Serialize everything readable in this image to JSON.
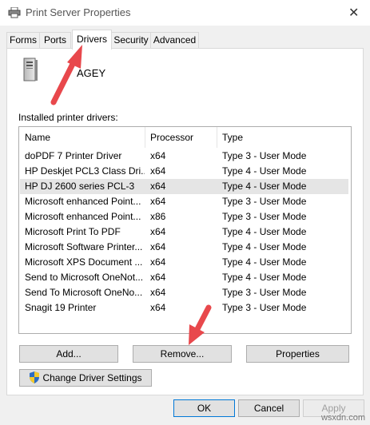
{
  "window": {
    "title": "Print Server Properties",
    "close_glyph": "✕"
  },
  "tabs": [
    {
      "label": "Forms"
    },
    {
      "label": "Ports"
    },
    {
      "label": "Drivers"
    },
    {
      "label": "Security"
    },
    {
      "label": "Advanced"
    }
  ],
  "server": {
    "name": "AGEY",
    "icon": "server-tower-icon"
  },
  "drivers": {
    "label": "Installed printer drivers:",
    "columns": [
      "Name",
      "Processor",
      "Type"
    ],
    "rows": [
      {
        "name": "doPDF 7 Printer Driver",
        "processor": "x64",
        "type": "Type 3 - User Mode"
      },
      {
        "name": "HP Deskjet PCL3 Class Dri...",
        "processor": "x64",
        "type": "Type 4 - User Mode"
      },
      {
        "name": "HP DJ 2600 series PCL-3",
        "processor": "x64",
        "type": "Type 4 - User Mode"
      },
      {
        "name": "Microsoft enhanced Point...",
        "processor": "x64",
        "type": "Type 3 - User Mode"
      },
      {
        "name": "Microsoft enhanced Point...",
        "processor": "x86",
        "type": "Type 3 - User Mode"
      },
      {
        "name": "Microsoft Print To PDF",
        "processor": "x64",
        "type": "Type 4 - User Mode"
      },
      {
        "name": "Microsoft Software Printer...",
        "processor": "x64",
        "type": "Type 4 - User Mode"
      },
      {
        "name": "Microsoft XPS Document ...",
        "processor": "x64",
        "type": "Type 4 - User Mode"
      },
      {
        "name": "Send to Microsoft OneNot...",
        "processor": "x64",
        "type": "Type 4 - User Mode"
      },
      {
        "name": "Send To Microsoft OneNo...",
        "processor": "x64",
        "type": "Type 3 - User Mode"
      },
      {
        "name": "Snagit 19 Printer",
        "processor": "x64",
        "type": "Type 3 - User Mode"
      }
    ]
  },
  "buttons": {
    "add": "Add...",
    "remove": "Remove...",
    "properties": "Properties",
    "change_driver_settings": "Change Driver Settings",
    "ok": "OK",
    "cancel": "Cancel",
    "apply": "Apply"
  },
  "watermark": "wsxdn.com",
  "colors": {
    "arrow": "#e8484c",
    "selected_row": "#e5e5e5",
    "button_face": "#e1e1e1",
    "default_button_border": "#0078d7"
  }
}
